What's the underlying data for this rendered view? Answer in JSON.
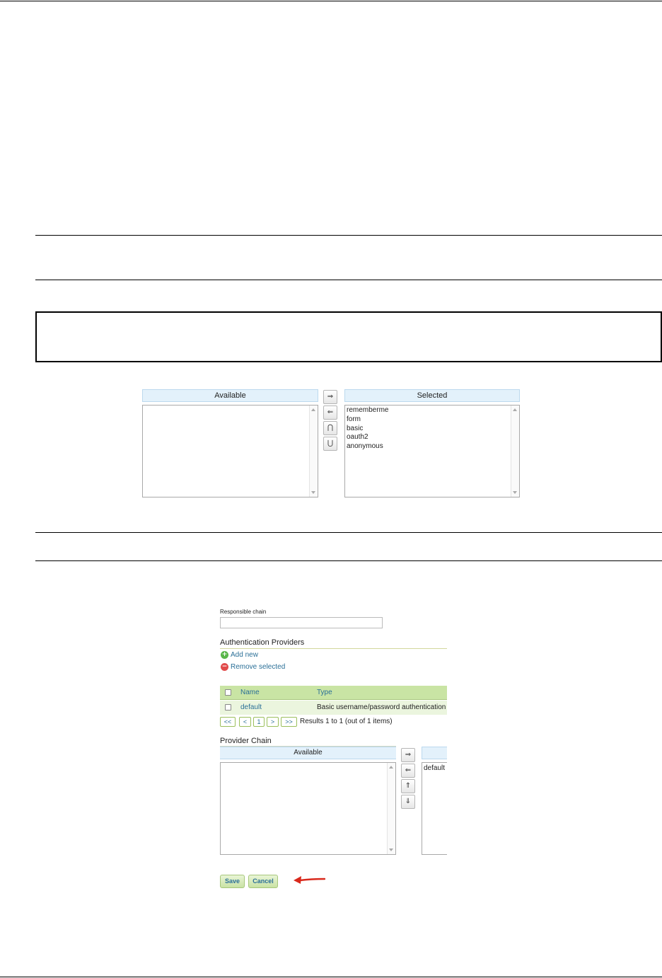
{
  "filter_chains": {
    "available_header": "Available",
    "selected_header": "Selected",
    "available_items": [],
    "selected_items": [
      "rememberme",
      "form",
      "basic",
      "oauth2",
      "anonymous"
    ],
    "move_buttons": [
      "⇒",
      "⇐",
      "⋂",
      "⋃"
    ]
  },
  "form": {
    "responsible_chain_label": "Responsible chain",
    "responsible_chain_value": "",
    "auth_providers_heading": "Authentication Providers",
    "add_new_label": "Add new",
    "remove_selected_label": "Remove selected",
    "table": {
      "columns": [
        "Name",
        "Type"
      ],
      "rows": [
        {
          "name": "default",
          "type": "Basic username/password authentication"
        }
      ]
    },
    "pagination": {
      "buttons": [
        "<<",
        "<",
        "1",
        ">",
        ">>"
      ],
      "summary": "Results 1 to 1 (out of 1 items)"
    },
    "provider_chain": {
      "heading": "Provider Chain",
      "available_header": "Available",
      "available_items": [],
      "selected_items": [
        "default"
      ],
      "move_buttons": [
        "⇒",
        "⇐",
        "⇑",
        "⇓"
      ]
    },
    "save_label": "Save",
    "cancel_label": "Cancel"
  },
  "colors": {
    "annotation_arrow": "#d9291c",
    "link": "#2a6f97",
    "table_header": "#c9e4a4"
  }
}
